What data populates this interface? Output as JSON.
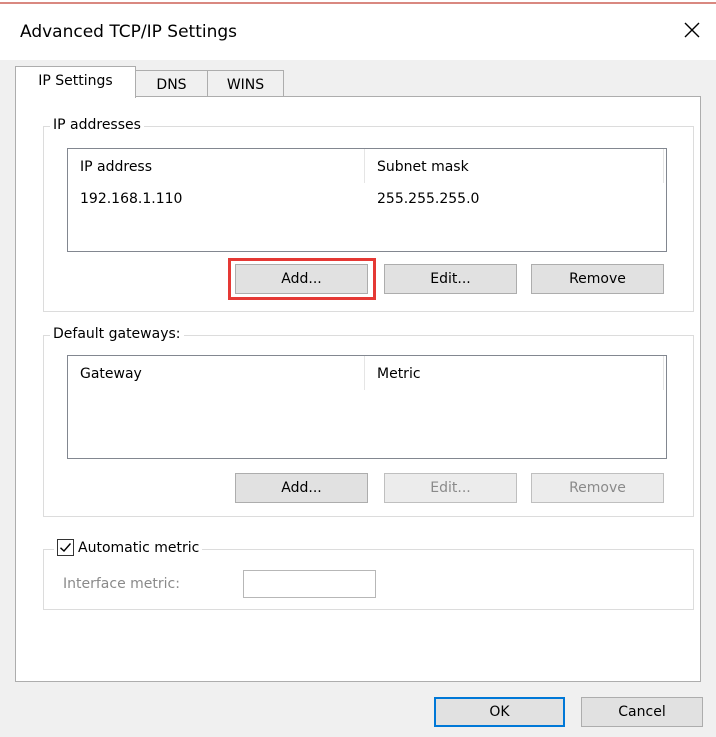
{
  "window": {
    "title": "Advanced TCP/IP Settings"
  },
  "tabs": [
    {
      "label": "IP Settings",
      "active": true
    },
    {
      "label": "DNS",
      "active": false
    },
    {
      "label": "WINS",
      "active": false
    }
  ],
  "ip_addresses": {
    "legend": "IP addresses",
    "columns": [
      "IP address",
      "Subnet mask"
    ],
    "rows": [
      {
        "ip": "192.168.1.110",
        "mask": "255.255.255.0"
      }
    ],
    "add_label": "Add...",
    "edit_label": "Edit...",
    "remove_label": "Remove"
  },
  "gateways": {
    "legend": "Default gateways:",
    "columns": [
      "Gateway",
      "Metric"
    ],
    "add_label": "Add...",
    "edit_label": "Edit...",
    "remove_label": "Remove"
  },
  "metric": {
    "checkbox_label": "Automatic metric",
    "checked": true,
    "interface_label": "Interface metric:",
    "interface_value": ""
  },
  "footer": {
    "ok_label": "OK",
    "cancel_label": "Cancel"
  },
  "colors": {
    "highlight": "#e53935",
    "accent": "#0078d7"
  }
}
